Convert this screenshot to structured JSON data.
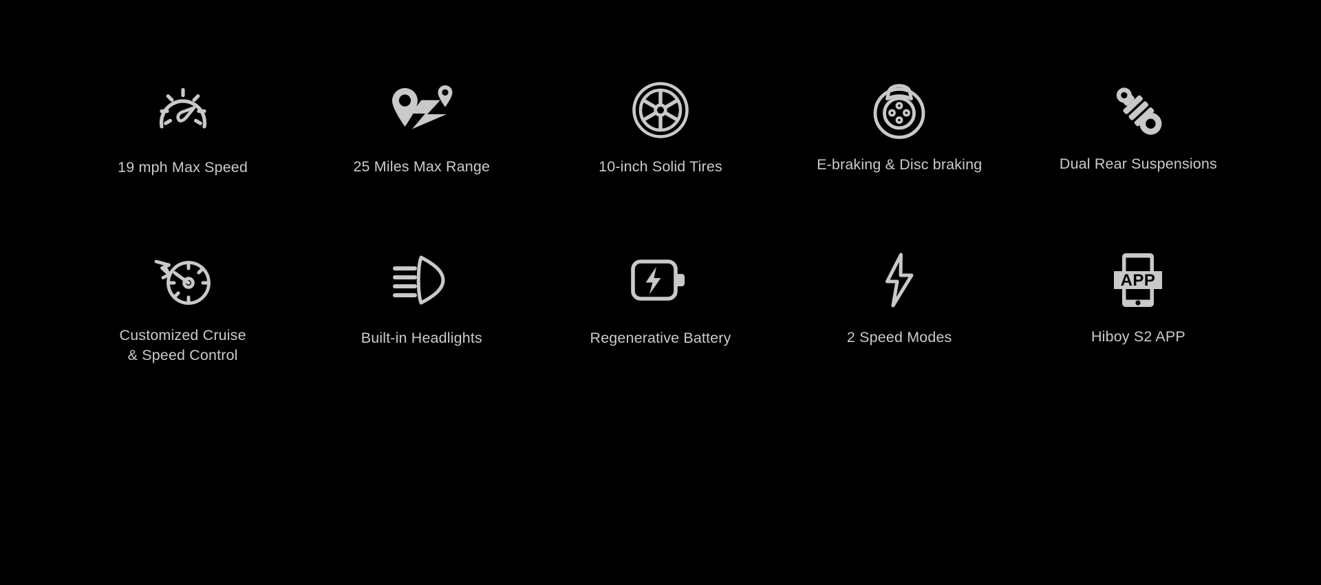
{
  "theme": {
    "background": "#000000",
    "icon_color": "#c9c9c9",
    "text_color": "#cbcbcb"
  },
  "features": {
    "row_top": [
      {
        "icon": "speedometer-icon",
        "label": "19 mph Max Speed"
      },
      {
        "icon": "route-map-pin-icon",
        "label": "25 Miles Max Range"
      },
      {
        "icon": "wheel-tire-icon",
        "label": "10-inch Solid Tires"
      },
      {
        "icon": "brake-disc-icon",
        "label": "E-braking & Disc braking"
      },
      {
        "icon": "shock-absorber-icon",
        "label": "Dual Rear Suspensions"
      }
    ],
    "row_bottom": [
      {
        "icon": "cruise-control-dial-icon",
        "label": "Customized Cruise\n& Speed Control"
      },
      {
        "icon": "headlight-icon",
        "label": "Built-in Headlights"
      },
      {
        "icon": "battery-bolt-icon",
        "label": "Regenerative Battery"
      },
      {
        "icon": "lightning-bolt-icon",
        "label": "2 Speed Modes"
      },
      {
        "icon": "phone-app-icon",
        "label": "Hiboy S2 APP"
      }
    ]
  }
}
